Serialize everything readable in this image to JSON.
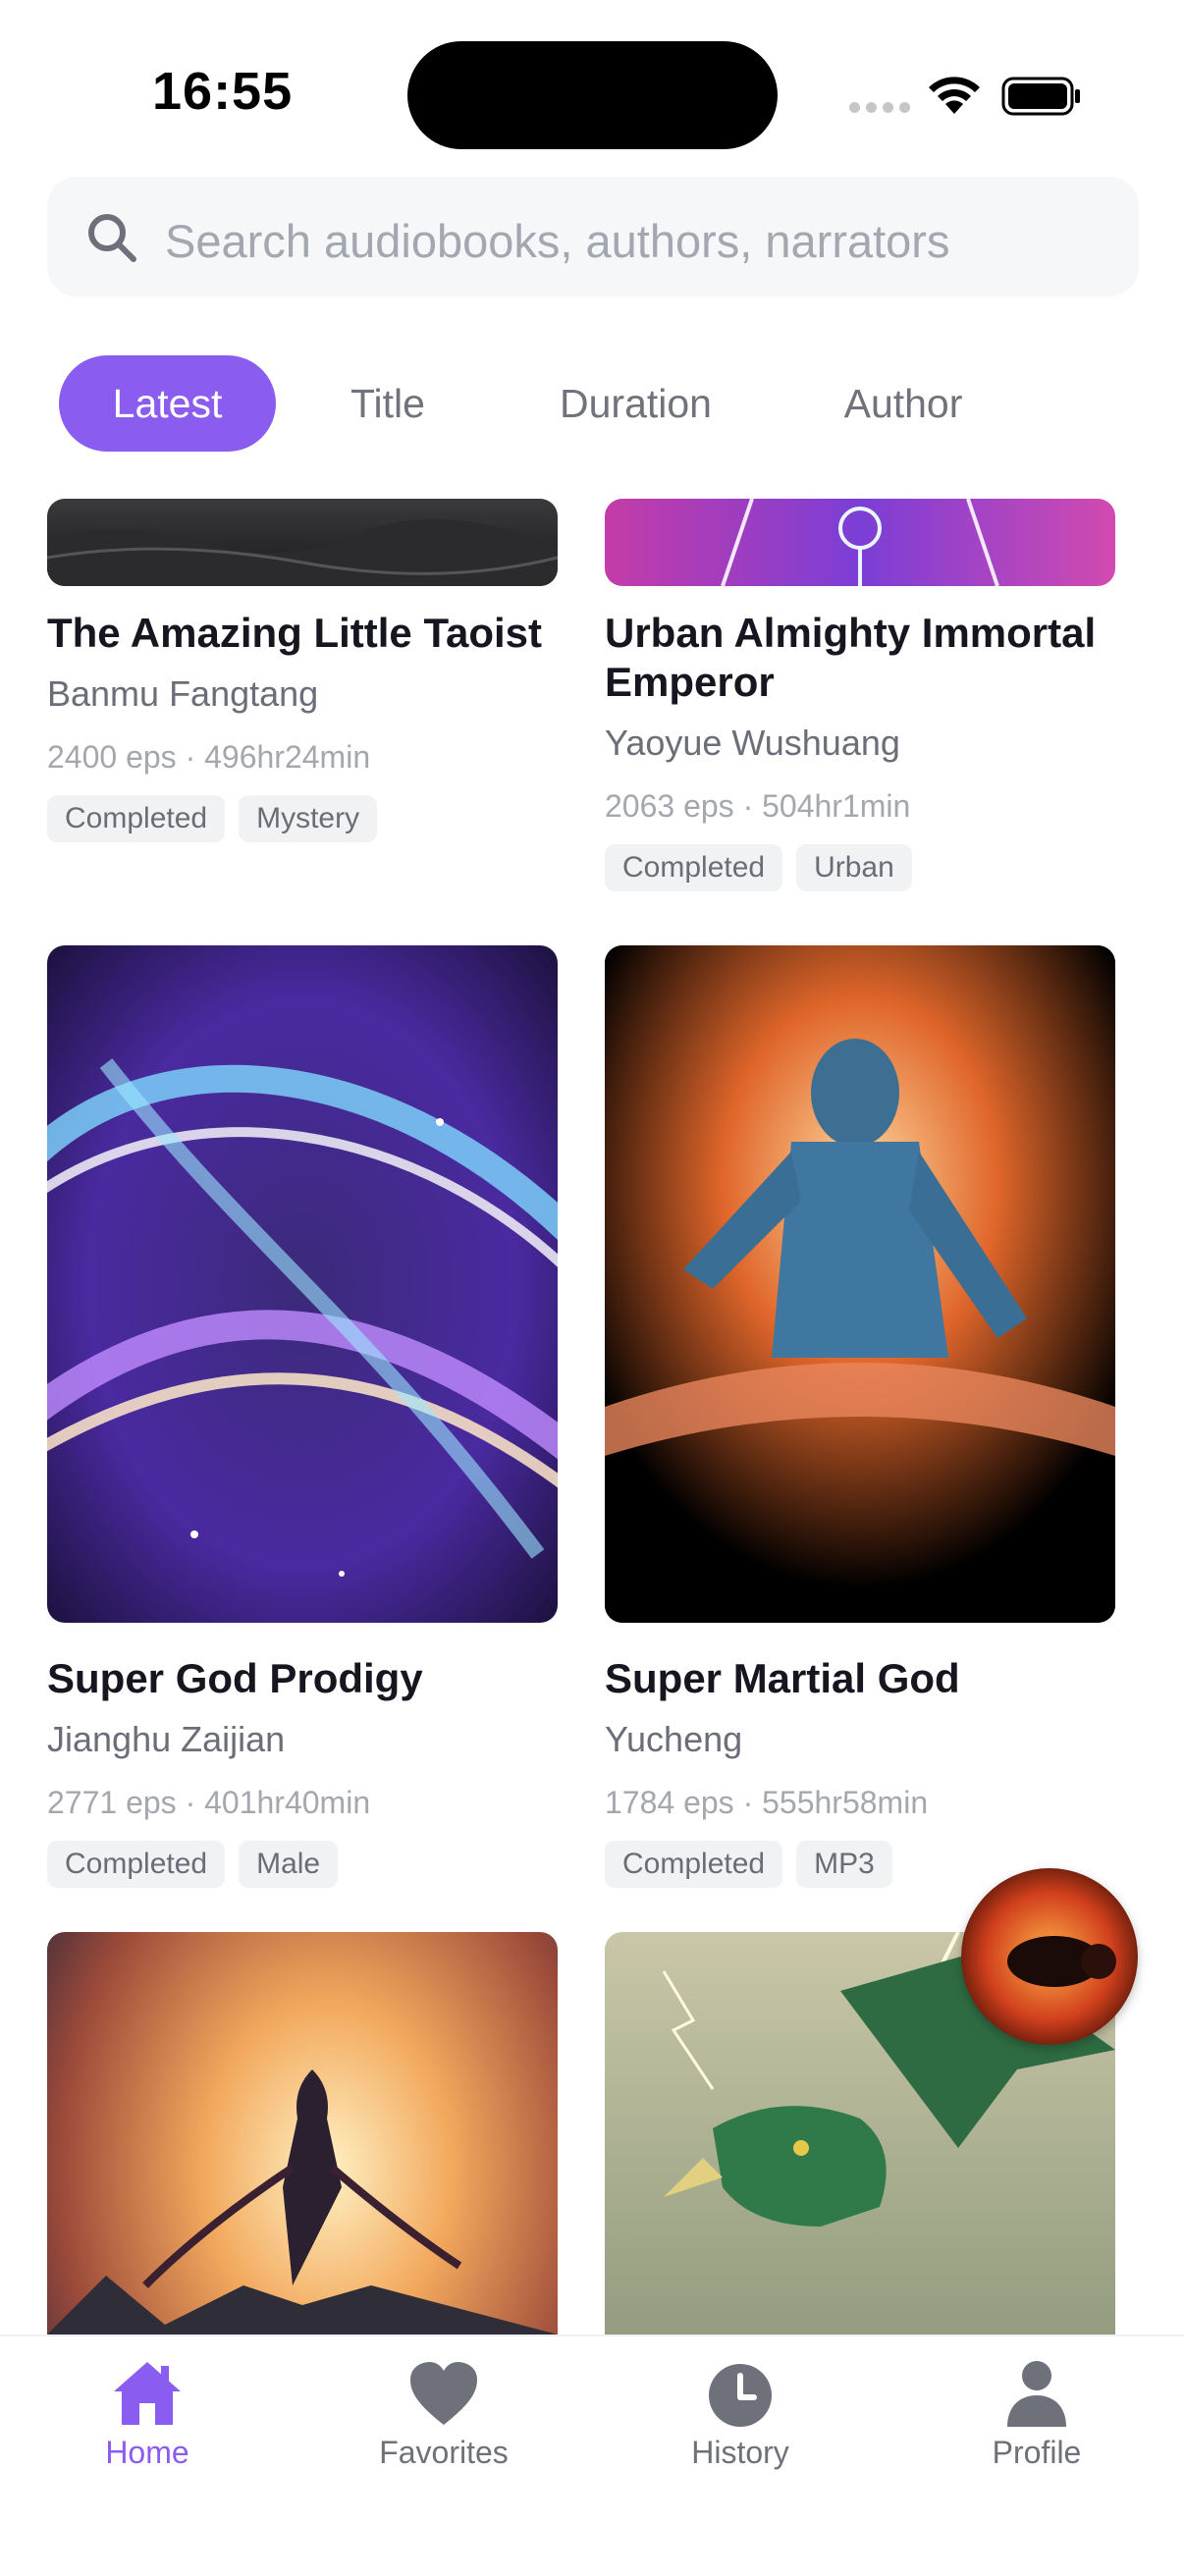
{
  "status_bar": {
    "time": "16:55"
  },
  "search": {
    "placeholder": "Search audiobooks, authors, narrators"
  },
  "tabs": [
    {
      "label": "Latest",
      "active": true
    },
    {
      "label": "Title",
      "active": false
    },
    {
      "label": "Duration",
      "active": false
    },
    {
      "label": "Author",
      "active": false
    }
  ],
  "books": [
    {
      "title": "The Amazing Little Taoist",
      "author": "Banmu Fangtang",
      "meta": "2400 eps · 496hr24min",
      "tags": [
        "Completed",
        "Mystery"
      ]
    },
    {
      "title": "Urban Almighty Immortal Emperor",
      "author": "Yaoyue Wushuang",
      "meta": "2063 eps · 504hr1min",
      "tags": [
        "Completed",
        "Urban"
      ]
    },
    {
      "title": "Super God Prodigy",
      "author": "Jianghu Zaijian",
      "meta": "2771 eps · 401hr40min",
      "tags": [
        "Completed",
        "Male"
      ]
    },
    {
      "title": "Super Martial God",
      "author": "Yucheng",
      "meta": "1784 eps · 555hr58min",
      "tags": [
        "Completed",
        "MP3"
      ]
    },
    {
      "title": "",
      "author": "",
      "meta": "",
      "tags": []
    },
    {
      "title": "",
      "author": "",
      "meta": "",
      "tags": []
    }
  ],
  "bottom_nav": [
    {
      "label": "Home",
      "icon": "home-icon",
      "active": true
    },
    {
      "label": "Favorites",
      "icon": "heart-icon",
      "active": false
    },
    {
      "label": "History",
      "icon": "clock-icon",
      "active": false
    },
    {
      "label": "Profile",
      "icon": "person-icon",
      "active": false
    }
  ],
  "colors": {
    "accent": "#8b5cf0",
    "text_primary": "#161620",
    "text_secondary": "#6b6e78",
    "text_muted": "#a4a7ae",
    "tag_bg": "#f1f2f4"
  }
}
